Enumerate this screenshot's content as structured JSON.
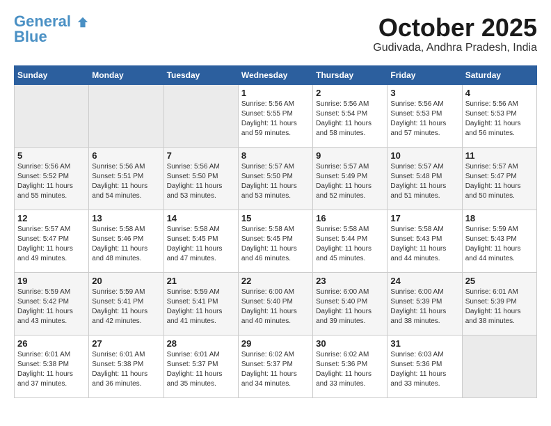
{
  "header": {
    "logo_line1": "General",
    "logo_line2": "Blue",
    "month": "October 2025",
    "location": "Gudivada, Andhra Pradesh, India"
  },
  "weekdays": [
    "Sunday",
    "Monday",
    "Tuesday",
    "Wednesday",
    "Thursday",
    "Friday",
    "Saturday"
  ],
  "weeks": [
    [
      {
        "day": "",
        "info": ""
      },
      {
        "day": "",
        "info": ""
      },
      {
        "day": "",
        "info": ""
      },
      {
        "day": "1",
        "info": "Sunrise: 5:56 AM\nSunset: 5:55 PM\nDaylight: 11 hours\nand 59 minutes."
      },
      {
        "day": "2",
        "info": "Sunrise: 5:56 AM\nSunset: 5:54 PM\nDaylight: 11 hours\nand 58 minutes."
      },
      {
        "day": "3",
        "info": "Sunrise: 5:56 AM\nSunset: 5:53 PM\nDaylight: 11 hours\nand 57 minutes."
      },
      {
        "day": "4",
        "info": "Sunrise: 5:56 AM\nSunset: 5:53 PM\nDaylight: 11 hours\nand 56 minutes."
      }
    ],
    [
      {
        "day": "5",
        "info": "Sunrise: 5:56 AM\nSunset: 5:52 PM\nDaylight: 11 hours\nand 55 minutes."
      },
      {
        "day": "6",
        "info": "Sunrise: 5:56 AM\nSunset: 5:51 PM\nDaylight: 11 hours\nand 54 minutes."
      },
      {
        "day": "7",
        "info": "Sunrise: 5:56 AM\nSunset: 5:50 PM\nDaylight: 11 hours\nand 53 minutes."
      },
      {
        "day": "8",
        "info": "Sunrise: 5:57 AM\nSunset: 5:50 PM\nDaylight: 11 hours\nand 53 minutes."
      },
      {
        "day": "9",
        "info": "Sunrise: 5:57 AM\nSunset: 5:49 PM\nDaylight: 11 hours\nand 52 minutes."
      },
      {
        "day": "10",
        "info": "Sunrise: 5:57 AM\nSunset: 5:48 PM\nDaylight: 11 hours\nand 51 minutes."
      },
      {
        "day": "11",
        "info": "Sunrise: 5:57 AM\nSunset: 5:47 PM\nDaylight: 11 hours\nand 50 minutes."
      }
    ],
    [
      {
        "day": "12",
        "info": "Sunrise: 5:57 AM\nSunset: 5:47 PM\nDaylight: 11 hours\nand 49 minutes."
      },
      {
        "day": "13",
        "info": "Sunrise: 5:58 AM\nSunset: 5:46 PM\nDaylight: 11 hours\nand 48 minutes."
      },
      {
        "day": "14",
        "info": "Sunrise: 5:58 AM\nSunset: 5:45 PM\nDaylight: 11 hours\nand 47 minutes."
      },
      {
        "day": "15",
        "info": "Sunrise: 5:58 AM\nSunset: 5:45 PM\nDaylight: 11 hours\nand 46 minutes."
      },
      {
        "day": "16",
        "info": "Sunrise: 5:58 AM\nSunset: 5:44 PM\nDaylight: 11 hours\nand 45 minutes."
      },
      {
        "day": "17",
        "info": "Sunrise: 5:58 AM\nSunset: 5:43 PM\nDaylight: 11 hours\nand 44 minutes."
      },
      {
        "day": "18",
        "info": "Sunrise: 5:59 AM\nSunset: 5:43 PM\nDaylight: 11 hours\nand 44 minutes."
      }
    ],
    [
      {
        "day": "19",
        "info": "Sunrise: 5:59 AM\nSunset: 5:42 PM\nDaylight: 11 hours\nand 43 minutes."
      },
      {
        "day": "20",
        "info": "Sunrise: 5:59 AM\nSunset: 5:41 PM\nDaylight: 11 hours\nand 42 minutes."
      },
      {
        "day": "21",
        "info": "Sunrise: 5:59 AM\nSunset: 5:41 PM\nDaylight: 11 hours\nand 41 minutes."
      },
      {
        "day": "22",
        "info": "Sunrise: 6:00 AM\nSunset: 5:40 PM\nDaylight: 11 hours\nand 40 minutes."
      },
      {
        "day": "23",
        "info": "Sunrise: 6:00 AM\nSunset: 5:40 PM\nDaylight: 11 hours\nand 39 minutes."
      },
      {
        "day": "24",
        "info": "Sunrise: 6:00 AM\nSunset: 5:39 PM\nDaylight: 11 hours\nand 38 minutes."
      },
      {
        "day": "25",
        "info": "Sunrise: 6:01 AM\nSunset: 5:39 PM\nDaylight: 11 hours\nand 38 minutes."
      }
    ],
    [
      {
        "day": "26",
        "info": "Sunrise: 6:01 AM\nSunset: 5:38 PM\nDaylight: 11 hours\nand 37 minutes."
      },
      {
        "day": "27",
        "info": "Sunrise: 6:01 AM\nSunset: 5:38 PM\nDaylight: 11 hours\nand 36 minutes."
      },
      {
        "day": "28",
        "info": "Sunrise: 6:01 AM\nSunset: 5:37 PM\nDaylight: 11 hours\nand 35 minutes."
      },
      {
        "day": "29",
        "info": "Sunrise: 6:02 AM\nSunset: 5:37 PM\nDaylight: 11 hours\nand 34 minutes."
      },
      {
        "day": "30",
        "info": "Sunrise: 6:02 AM\nSunset: 5:36 PM\nDaylight: 11 hours\nand 33 minutes."
      },
      {
        "day": "31",
        "info": "Sunrise: 6:03 AM\nSunset: 5:36 PM\nDaylight: 11 hours\nand 33 minutes."
      },
      {
        "day": "",
        "info": ""
      }
    ]
  ]
}
